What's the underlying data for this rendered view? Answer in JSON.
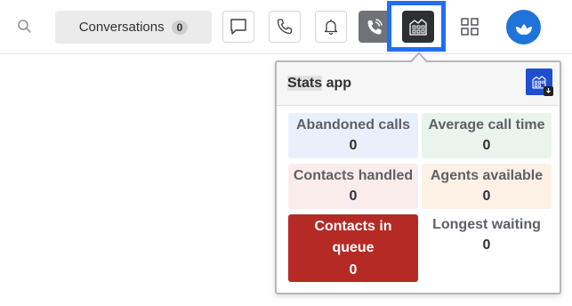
{
  "topbar": {
    "search_icon": "search-icon",
    "conversations_label": "Conversations",
    "conversations_count": "0",
    "icons": [
      "message-icon",
      "phone-icon",
      "bell-icon",
      "phone-active-icon",
      "stats-app-icon",
      "apps-grid-icon",
      "avatar-leaf-icon"
    ],
    "accent_color": "#1f6ff0",
    "avatar_color": "#1f73d9"
  },
  "popover": {
    "title_highlight": "Stats",
    "title_rest": " app",
    "tiles": [
      {
        "label": "Abandoned calls",
        "value": "0",
        "color": "#e8f1fb"
      },
      {
        "label": "Average call time",
        "value": "0",
        "color": "#e9f4ec"
      },
      {
        "label": "Contacts handled",
        "value": "0",
        "color": "#fbecec"
      },
      {
        "label": "Agents available",
        "value": "0",
        "color": "#fdf1e6"
      },
      {
        "label": "Contacts in queue",
        "value": "0",
        "color": "#b52a24"
      },
      {
        "label": "Longest waiting",
        "value": "0",
        "color": "#ffffff"
      }
    ]
  }
}
